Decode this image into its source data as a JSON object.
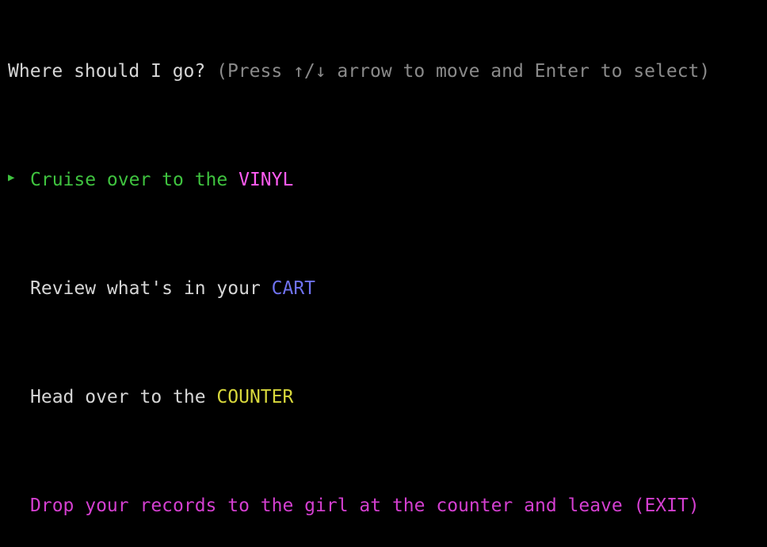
{
  "prompt": {
    "question": "Where should I go?",
    "hint": "(Press ↑/↓ arrow to move and Enter to select)"
  },
  "pointer_icon": "triangle-right-icon",
  "choices": [
    {
      "text": "Cruise over to the ",
      "highlight": "VINYL",
      "selected": true
    },
    {
      "text": "Review what's in your ",
      "highlight": "CART",
      "selected": false
    },
    {
      "text": "Head over to the ",
      "highlight": "COUNTER",
      "selected": false
    },
    {
      "text": "Drop your records to the girl at the counter and leave (EXIT)",
      "highlight": "",
      "selected": false
    }
  ],
  "colors": {
    "background": "#000000",
    "default_text": "#d6d6d6",
    "hint": "#8a8a8a",
    "selected": "#3fc33f",
    "vinyl": "#ff5cf2",
    "cart": "#6f72f0",
    "counter": "#d8d83c",
    "exit": "#d43fd0"
  }
}
